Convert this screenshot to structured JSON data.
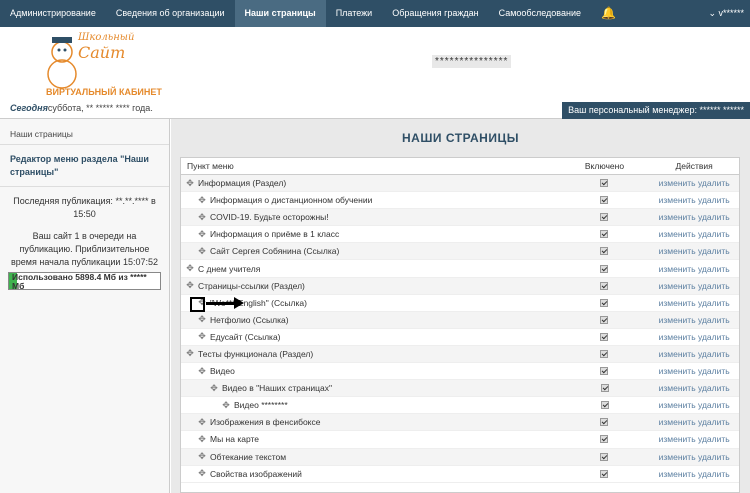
{
  "nav": {
    "items": [
      "Администрирование",
      "Сведения об организации",
      "Наши страницы",
      "Платежи",
      "Обращения граждан",
      "Самообследование"
    ],
    "active_index": 2,
    "user": "v******"
  },
  "header": {
    "logo_line1": "Школьный",
    "logo_line2": "Сайт",
    "cabinet": "ВИРТУАЛЬНЫЙ КАБИНЕТ",
    "today_label": "Сегодня",
    "today_value": "суббота, ** ***** **** года.",
    "center_stars": "***************",
    "manager": "Ваш персональный менеджер: ****** ******"
  },
  "sidebar": {
    "crumb": "Наши страницы",
    "title": "Редактор меню раздела \"Наши страницы\"",
    "last_pub": "Последняя публикация: **.**.**** в 15:50",
    "queue": "Ваш сайт 1 в очереди на публикацию. Приблизительное время начала публикации 15:07:52",
    "usage": "Использовано 5898.4 Мб из ***** Мб",
    "usage_fraction": 0.05
  },
  "main": {
    "title": "НАШИ СТРАНИЦЫ",
    "col_item": "Пункт меню",
    "col_enabled": "Включено",
    "col_actions": "Действия",
    "action_label": "изменить удалить",
    "rows": [
      {
        "label": "Информация (Раздел)",
        "level": 0
      },
      {
        "label": "Информация о дистанционном обучении",
        "level": 1
      },
      {
        "label": "COVID-19. Будьте осторожны!",
        "level": 1
      },
      {
        "label": "Информация о приёме в 1 класс",
        "level": 1
      },
      {
        "label": "Сайт Сергея Собянина (Ссылка)",
        "level": 1
      },
      {
        "label": "С днем учителя",
        "level": 0
      },
      {
        "label": "Страницы-ссылки (Раздел)",
        "level": 0
      },
      {
        "label": "\"Wo*** English\" (Ссылка)",
        "level": 1
      },
      {
        "label": "Нетфолио (Ссылка)",
        "level": 1
      },
      {
        "label": "Едусайт (Ссылка)",
        "level": 1
      },
      {
        "label": "Тесты функционала (Раздел)",
        "level": 0
      },
      {
        "label": "Видео",
        "level": 1
      },
      {
        "label": "Видео в \"Наших страницах\"",
        "level": 2
      },
      {
        "label": "Видео ********",
        "level": 3
      },
      {
        "label": "Изображения в фенсибоксе",
        "level": 1
      },
      {
        "label": "Мы на карте",
        "level": 1
      },
      {
        "label": "Обтекание текстом",
        "level": 1
      },
      {
        "label": "Свойства изображений",
        "level": 1
      }
    ]
  }
}
